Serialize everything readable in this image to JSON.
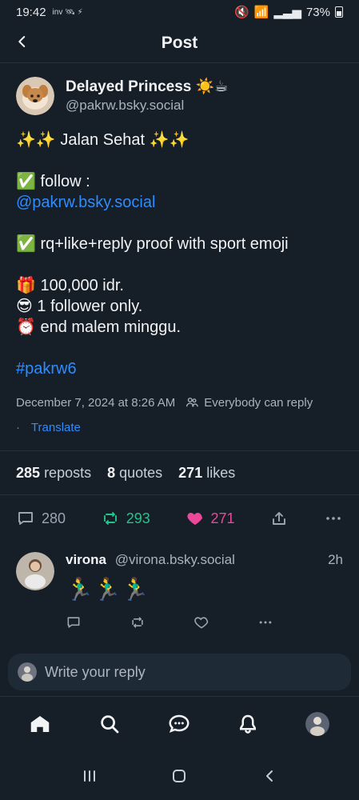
{
  "status_bar": {
    "time": "19:42",
    "left_extra": "inv 🛰 ⚡",
    "battery_text": "73%"
  },
  "header": {
    "title": "Post"
  },
  "post": {
    "author_name": "Delayed Princess ☀️☕",
    "author_handle": "@pakrw.bsky.social",
    "lines": [
      "✨✨ Jalan Sehat ✨✨",
      "",
      "✅ follow :",
      "@pakrw.bsky.social",
      "",
      "✅ rq+like+reply proof with sport emoji",
      "",
      "🎁 100,000 idr.",
      "😎 1 follower only.",
      "⏰  end malem minggu.",
      "",
      "#pakrw6"
    ],
    "meta": {
      "date_time": "December 7, 2024 at 8:26 AM",
      "reply_scope": "Everybody can reply",
      "translate": "Translate"
    },
    "stats": [
      {
        "value": "285",
        "label": "reposts"
      },
      {
        "value": "8",
        "label": "quotes"
      },
      {
        "value": "271",
        "label": "likes"
      }
    ],
    "actions": {
      "reply_count": "280",
      "repost_count": "293",
      "like_count": "271"
    }
  },
  "reply": {
    "name": "virona",
    "handle": "@virona.bsky.social",
    "time": "2h",
    "text": "🏃‍♂️🏃‍♂️🏃‍♂️"
  },
  "composer": {
    "placeholder": "Write your reply"
  },
  "colors": {
    "background": "#161e27",
    "link": "#2f8cff",
    "repost": "#22c58b",
    "like": "#ec4899"
  }
}
